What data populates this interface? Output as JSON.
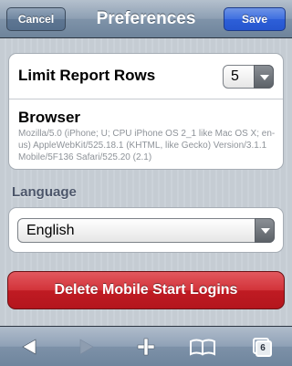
{
  "navbar": {
    "title": "Preferences",
    "cancel_label": "Cancel",
    "save_label": "Save"
  },
  "settings": {
    "limit_rows": {
      "label": "Limit Report Rows",
      "value": "5"
    },
    "browser": {
      "label": "Browser",
      "user_agent": "Mozilla/5.0 (iPhone; U; CPU iPhone OS 2_1 like Mac OS X; en-us) AppleWebKit/525.18.1 (KHTML, like Gecko) Version/3.1.1 Mobile/5F136 Safari/525.20 (2.1)"
    }
  },
  "language": {
    "section_label": "Language",
    "value": "English"
  },
  "actions": {
    "delete_label": "Delete Mobile Start Logins"
  },
  "toolbar": {
    "back_icon": "back-arrow-icon",
    "forward_icon": "forward-arrow-icon",
    "add_icon": "plus-icon",
    "bookmarks_icon": "book-icon",
    "pages_icon": "pages-icon",
    "pages_count": "6"
  },
  "colors": {
    "save_blue": "#2d5fd8",
    "delete_red": "#c01b23",
    "nav_gray": "#7f93a9"
  }
}
